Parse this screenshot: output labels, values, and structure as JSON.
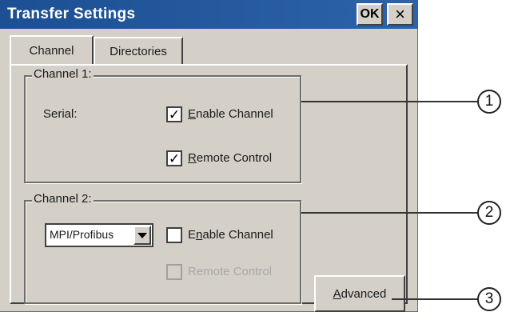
{
  "window": {
    "title": "Transfer Settings",
    "ok_label": "OK",
    "close_label": "×"
  },
  "tabs": [
    {
      "label": "Channel",
      "active": true
    },
    {
      "label": "Directories",
      "active": false
    }
  ],
  "channel1": {
    "legend": "Channel 1:",
    "serial_label": "Serial:",
    "enable_channel": {
      "label_prefix": "",
      "underline": "E",
      "label_rest": "nable Channel",
      "checked": true
    },
    "remote_control": {
      "underline": "R",
      "label_rest": "emote Control",
      "checked": true
    }
  },
  "channel2": {
    "legend": "Channel 2:",
    "protocol_value": "MPI/Profibus",
    "enable_channel": {
      "label_prefix": "E",
      "underline": "n",
      "label_rest": "able Channel",
      "checked": false
    },
    "remote_control": {
      "label": "Remote Control",
      "checked": false,
      "disabled": true
    }
  },
  "advanced_button": {
    "underline": "A",
    "label_rest": "dvanced"
  },
  "callouts": [
    "1",
    "2",
    "3"
  ],
  "icons": {
    "checkmark": "✓",
    "dropdown": "triangle-down"
  }
}
